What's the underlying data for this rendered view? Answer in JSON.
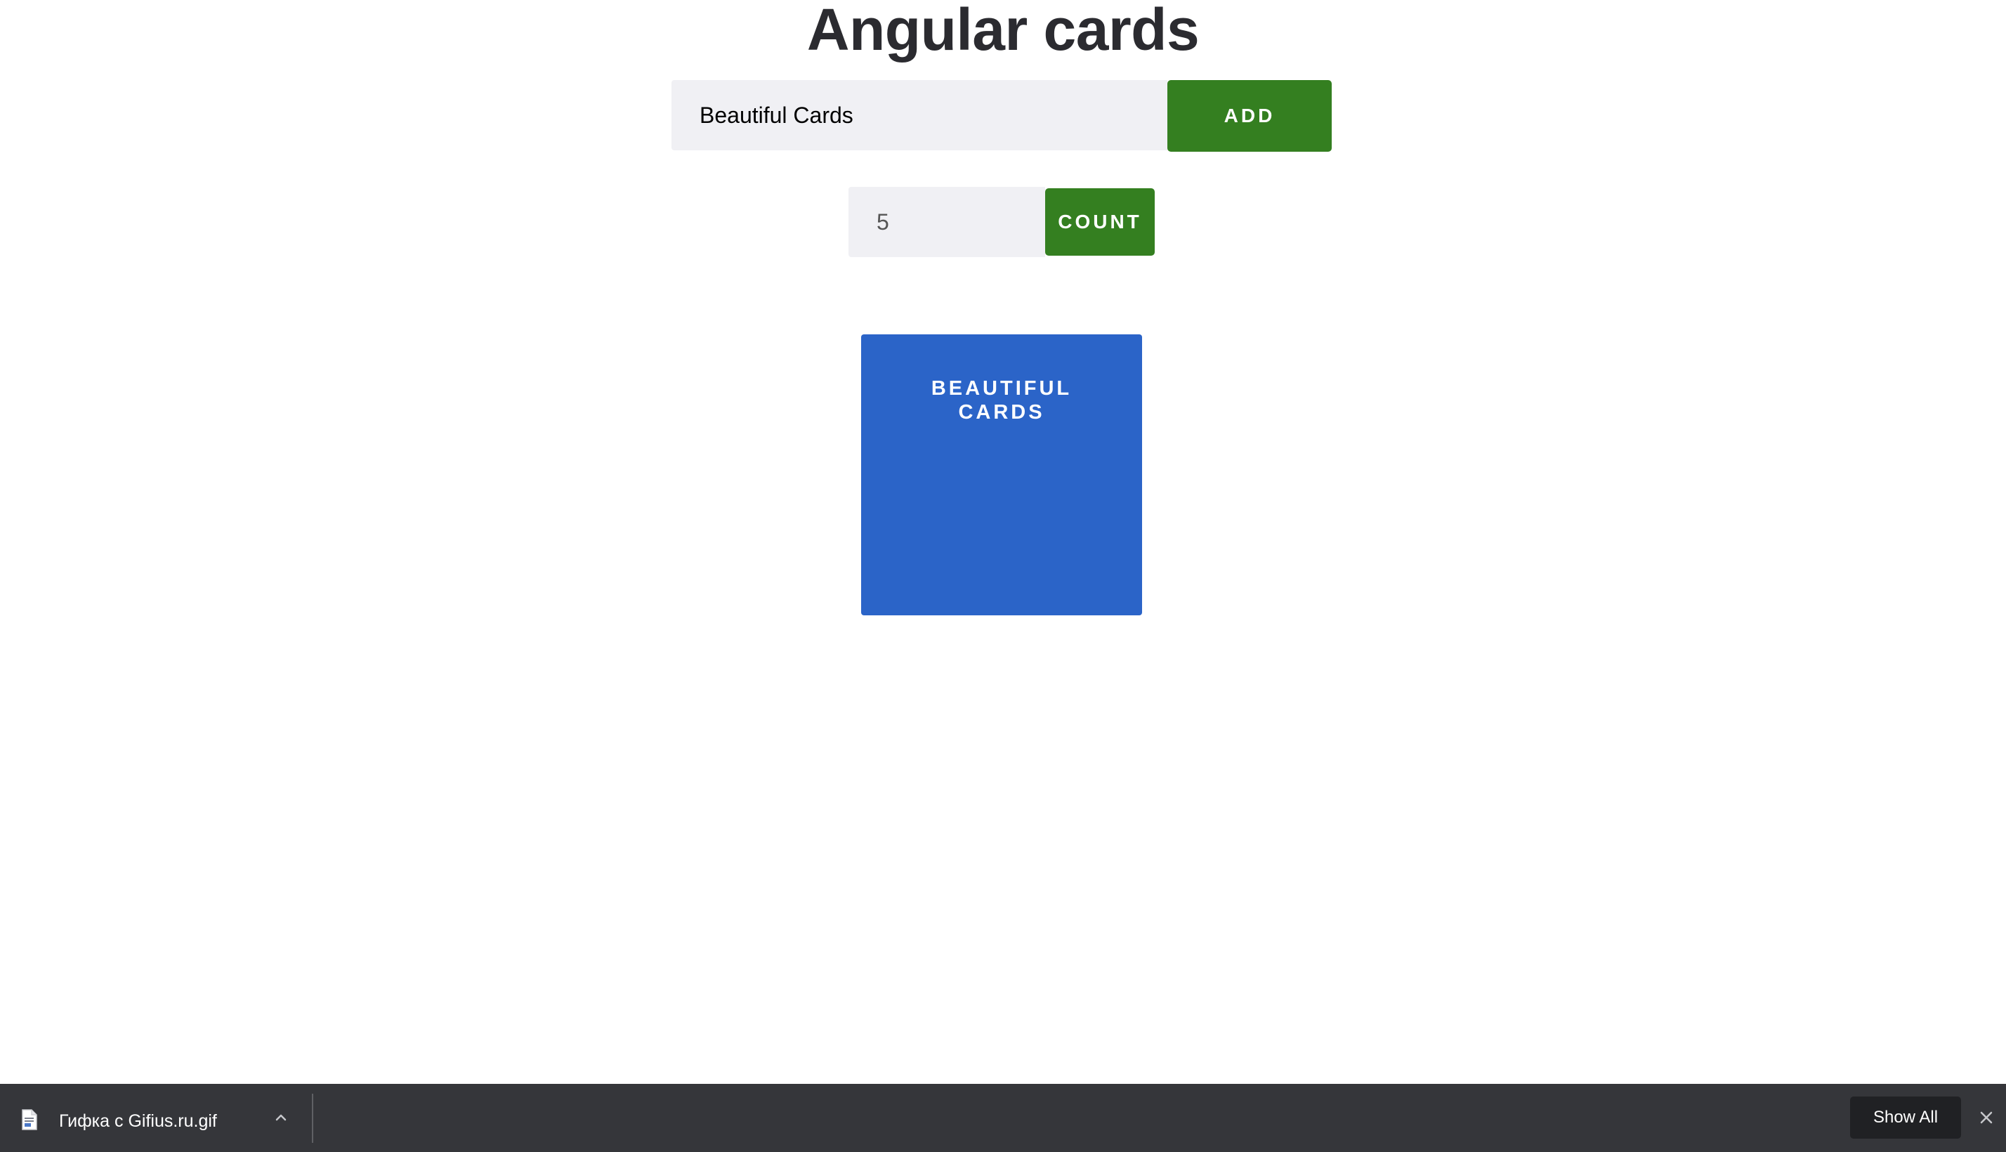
{
  "page": {
    "title": "Angular cards"
  },
  "add_form": {
    "input_value": "Beautiful Cards",
    "button_label": "ADD"
  },
  "count_form": {
    "input_value": "5",
    "button_label": "COUNT"
  },
  "cards": [
    {
      "title": "Beautiful Cards"
    }
  ],
  "download_bar": {
    "file_name": "Гифка с Gifius.ru.gif",
    "file_icon": "document-icon",
    "expand_icon": "chevron-up-icon",
    "show_all_label": "Show All",
    "close_icon": "close-icon"
  },
  "colors": {
    "button_green": "#347f20",
    "card_blue": "#2b64c8",
    "input_bg": "#f0f0f4",
    "title_text": "#2b2b30",
    "download_bar_bg": "#35363a"
  }
}
